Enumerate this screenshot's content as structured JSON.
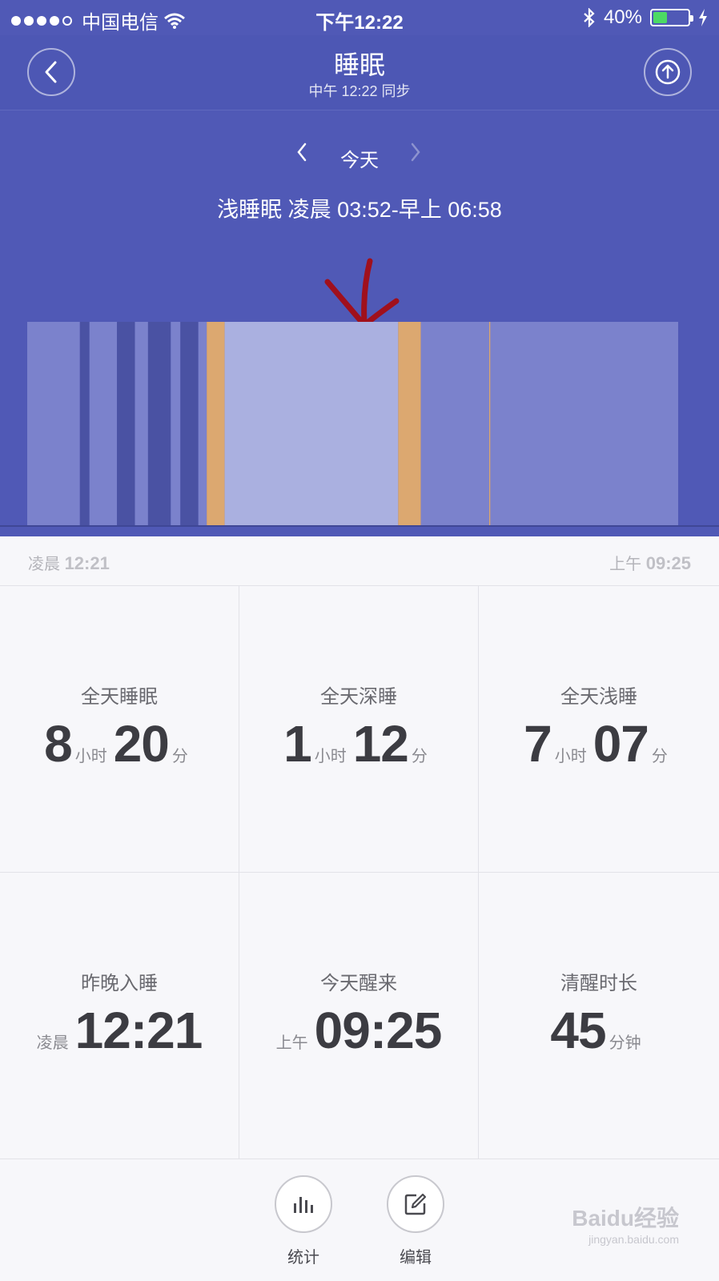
{
  "statusbar": {
    "carrier": "中国电信",
    "time": "下午12:22",
    "battery": "40%",
    "battery_level": 0.4
  },
  "nav": {
    "title": "睡眠",
    "subtitle": "中午 12:22 同步"
  },
  "date_nav": {
    "label": "今天"
  },
  "stage_info": "浅睡眠 凌晨 03:52-早上 06:58",
  "chart_data": {
    "type": "bar",
    "x_start": "00:21",
    "x_end": "09:25",
    "stage_colors": {
      "light": "#7b82cc",
      "deep": "#4a52a3",
      "awake": "#dca870",
      "selected": "#aab0e0"
    },
    "segments": [
      {
        "stage": "light",
        "start": "00:21",
        "end": "01:05"
      },
      {
        "stage": "deep",
        "start": "01:05",
        "end": "01:13"
      },
      {
        "stage": "light",
        "start": "01:13",
        "end": "01:36"
      },
      {
        "stage": "deep",
        "start": "01:36",
        "end": "01:51"
      },
      {
        "stage": "light",
        "start": "01:51",
        "end": "02:02"
      },
      {
        "stage": "deep",
        "start": "02:02",
        "end": "02:21"
      },
      {
        "stage": "light",
        "start": "02:21",
        "end": "02:29"
      },
      {
        "stage": "deep",
        "start": "02:29",
        "end": "02:44"
      },
      {
        "stage": "light",
        "start": "02:44",
        "end": "02:51"
      },
      {
        "stage": "awake",
        "start": "02:51",
        "end": "03:06"
      },
      {
        "stage": "selected",
        "start": "03:06",
        "end": "05:31"
      },
      {
        "stage": "awake",
        "start": "05:31",
        "end": "05:50"
      },
      {
        "stage": "light",
        "start": "05:50",
        "end": "06:47"
      },
      {
        "stage": "awake",
        "start": "06:47",
        "end": "06:48"
      },
      {
        "stage": "light",
        "start": "06:48",
        "end": "09:25"
      }
    ]
  },
  "axis": {
    "start_prefix": "凌晨",
    "start_time": "12:21",
    "end_prefix": "上午",
    "end_time": "09:25"
  },
  "stats": {
    "total_sleep": {
      "label": "全天睡眠",
      "hours": "8",
      "hours_unit": "小时",
      "minutes": "20",
      "minutes_unit": "分"
    },
    "deep_sleep": {
      "label": "全天深睡",
      "hours": "1",
      "hours_unit": "小时",
      "minutes": "12",
      "minutes_unit": "分"
    },
    "light_sleep": {
      "label": "全天浅睡",
      "hours": "7",
      "hours_unit": "小时",
      "minutes": "07",
      "minutes_unit": "分"
    },
    "bedtime": {
      "label": "昨晚入睡",
      "prefix": "凌晨",
      "time": "12:21"
    },
    "wake": {
      "label": "今天醒来",
      "prefix": "上午",
      "time": "09:25"
    },
    "awake": {
      "label": "清醒时长",
      "value": "45",
      "unit": "分钟"
    }
  },
  "toolbar": {
    "stats_label": "统计",
    "edit_label": "编辑"
  },
  "watermark": {
    "brand": "Baidu经验",
    "url": "jingyan.baidu.com"
  }
}
